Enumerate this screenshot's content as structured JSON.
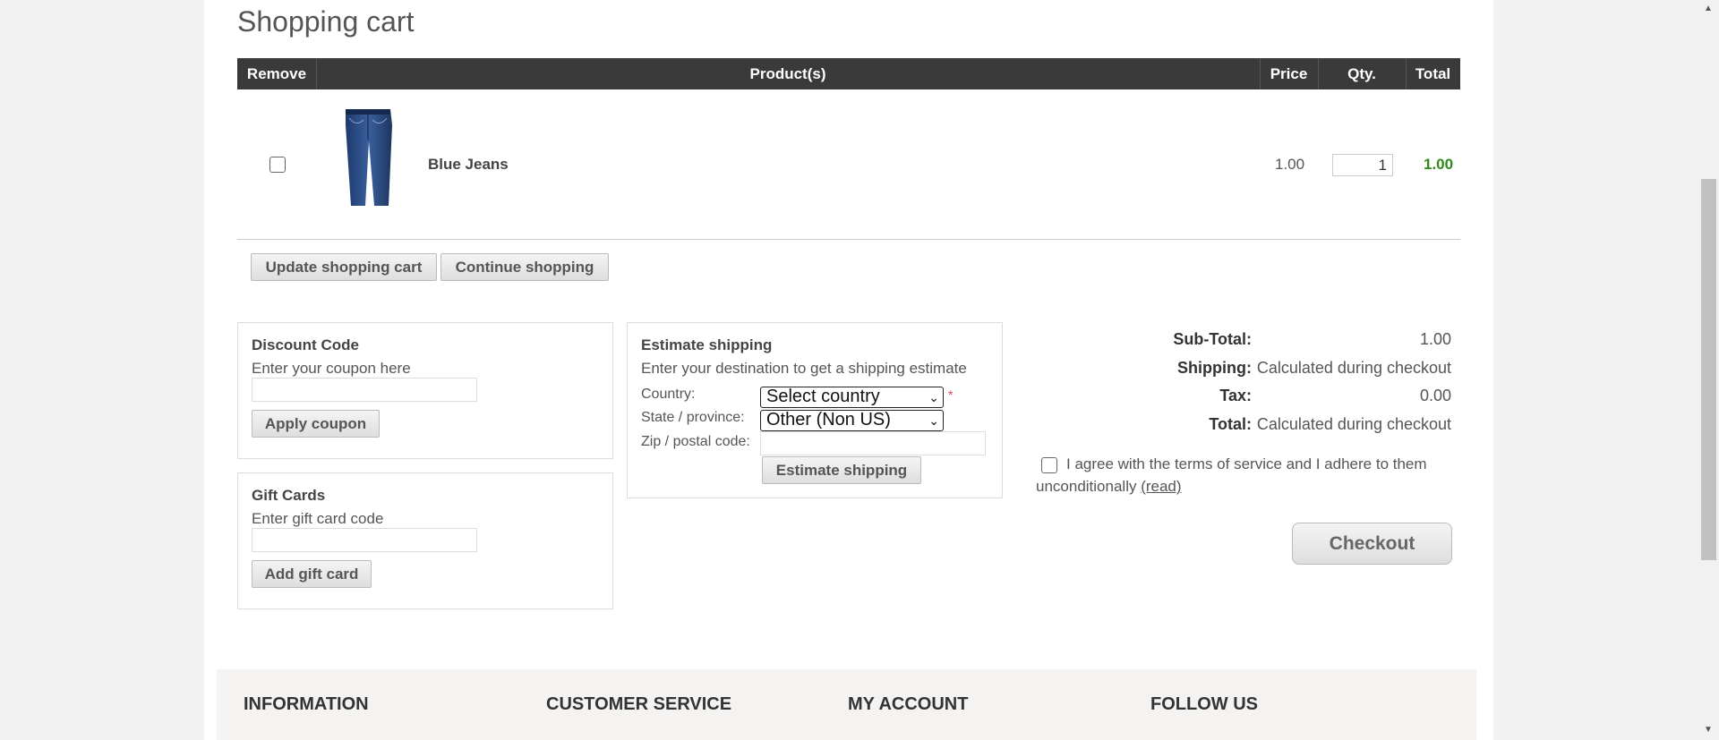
{
  "page": {
    "title": "Shopping cart"
  },
  "table": {
    "headers": {
      "remove": "Remove",
      "products": "Product(s)",
      "price": "Price",
      "qty": "Qty.",
      "total": "Total"
    },
    "rows": [
      {
        "name": "Blue Jeans",
        "price": "1.00",
        "qty": "1",
        "total": "1.00",
        "image": "blue-jeans-image"
      }
    ]
  },
  "buttons": {
    "update_cart": "Update shopping cart",
    "continue_shopping": "Continue shopping",
    "apply_coupon": "Apply coupon",
    "add_gift_card": "Add gift card",
    "estimate_shipping": "Estimate shipping",
    "checkout": "Checkout"
  },
  "discount": {
    "title": "Discount Code",
    "hint": "Enter your coupon here",
    "value": ""
  },
  "giftcard": {
    "title": "Gift Cards",
    "hint": "Enter gift card code",
    "value": ""
  },
  "shipping": {
    "title": "Estimate shipping",
    "hint": "Enter your destination to get a shipping estimate",
    "country_label": "Country:",
    "country_value": "Select country",
    "required_mark": "*",
    "state_label": "State / province:",
    "state_value": "Other (Non US)",
    "zip_label": "Zip / postal code:",
    "zip_value": ""
  },
  "totals": {
    "subtotal_label": "Sub-Total:",
    "subtotal_value": "1.00",
    "shipping_label": "Shipping:",
    "shipping_value": "Calculated during checkout",
    "tax_label": "Tax:",
    "tax_value": "0.00",
    "total_label": "Total:",
    "total_value": "Calculated during checkout"
  },
  "terms": {
    "text_line1": "I agree with the terms of service and I adhere to them",
    "text_line2": "unconditionally",
    "read_link": "(read)"
  },
  "footer": {
    "col1": "INFORMATION",
    "col2": "CUSTOMER SERVICE",
    "col3": "MY ACCOUNT",
    "col4": "FOLLOW US"
  },
  "colors": {
    "header_bg": "#3a3a3a",
    "total_green": "#2e8b1a",
    "required_red": "#e4434b"
  }
}
